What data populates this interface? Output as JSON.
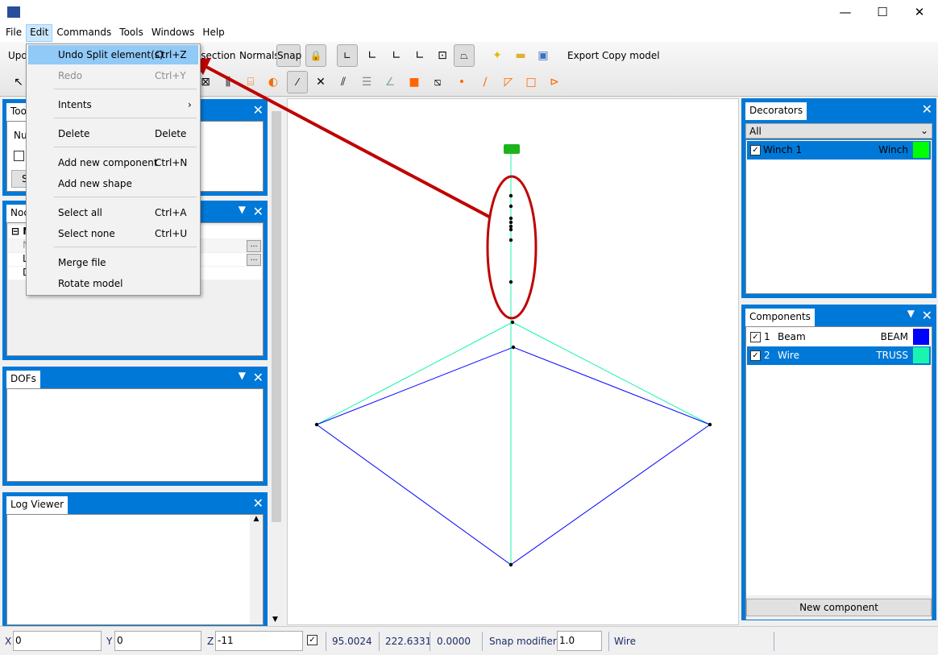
{
  "menubar": [
    "File",
    "Edit",
    "Commands",
    "Tools",
    "Windows",
    "Help"
  ],
  "toolbar": {
    "update_partial": "Upd",
    "bisection_partial": "ssection",
    "normals": "Normals",
    "snap": "Snap",
    "export": "Export",
    "copy_model": "Copy model"
  },
  "edit_menu": [
    {
      "label": "Undo Split element(s)",
      "shortcut": "Ctrl+Z",
      "highlighted": true
    },
    {
      "label": "Redo",
      "shortcut": "Ctrl+Y",
      "disabled": true
    },
    {
      "label": "Intents",
      "submenu": true
    },
    {
      "label": "Delete",
      "shortcut": "Delete"
    },
    {
      "label": "Add new component",
      "shortcut": "Ctrl+N"
    },
    {
      "label": "Add new shape",
      "shortcut": ""
    },
    {
      "label": "Select all",
      "shortcut": "Ctrl+A"
    },
    {
      "label": "Select none",
      "shortcut": "Ctrl+U"
    },
    {
      "label": "Merge file",
      "shortcut": ""
    },
    {
      "label": "Rotate model",
      "shortcut": ""
    }
  ],
  "panels": {
    "tool": {
      "title": "Tool",
      "num_label": "Num",
      "button": "S"
    },
    "node": {
      "title": "Node",
      "rows": [
        "N",
        "N",
        "L",
        "D"
      ]
    },
    "dofs": {
      "title": "DOFs"
    },
    "log": {
      "title": "Log Viewer"
    },
    "decorators": {
      "title": "Decorators",
      "filter": "All",
      "items": [
        {
          "name": "Winch 1",
          "type": "Winch",
          "color": "#00ff00",
          "checked": true
        }
      ]
    },
    "components": {
      "title": "Components",
      "items": [
        {
          "id": "1",
          "name": "Beam",
          "type": "BEAM",
          "color": "#0000ff",
          "checked": true
        },
        {
          "id": "2",
          "name": "Wire",
          "type": "TRUSS",
          "color": "#19f5b0",
          "checked": true
        }
      ],
      "new_button": "New component"
    }
  },
  "status": {
    "x_label": "X",
    "x": "0",
    "y_label": "Y",
    "y": "0",
    "z_label": "Z",
    "z": "-11",
    "v1": "95.0024",
    "v2": "222.6331",
    "v3": "0.0000",
    "snap_modifier_label": "Snap modifier",
    "snap_modifier": "1.0",
    "component": "Wire"
  },
  "colors": {
    "accent": "#0078d7",
    "beam": "#0000ff",
    "wire": "#19f5b0",
    "winch": "#00ff00",
    "annotation": "#c00000"
  }
}
